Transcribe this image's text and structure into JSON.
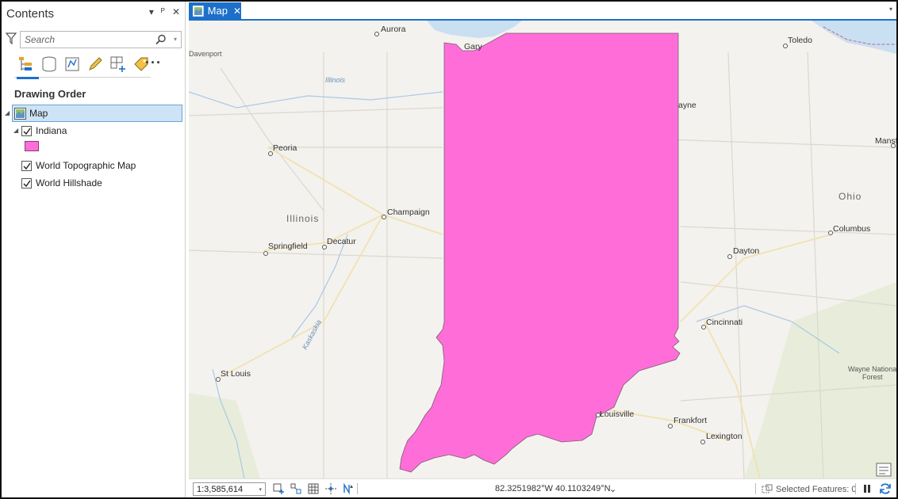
{
  "contents": {
    "title": "Contents",
    "pin_glyph": "▾  ⊥  ✕",
    "search": {
      "placeholder": "Search"
    },
    "toolbar_icons": [
      "list-by-drawing-order-icon",
      "list-by-data-source-icon",
      "list-by-selection-icon",
      "list-by-editing-icon",
      "list-by-snapping-icon",
      "list-by-labeling-icon",
      "more-icon"
    ],
    "section_title": "Drawing Order",
    "tree": {
      "map_label": "Map",
      "layers": [
        {
          "label": "Indiana",
          "checked": true,
          "expanded": true,
          "symbol_color": "#ff6ed8"
        },
        {
          "label": "World Topographic Map",
          "checked": true
        },
        {
          "label": "World Hillshade",
          "checked": true
        }
      ]
    }
  },
  "map_view": {
    "tab_label": "Map",
    "tab_close": "✕",
    "labels": {
      "aurora": "Aurora",
      "gary": "Gary",
      "toledo": "Toledo",
      "davenport": "Davenport",
      "illinois_river": "Illinois",
      "wayne": "ayne",
      "peoria": "Peoria",
      "mansf": "Mansf",
      "ohio": "Ohio",
      "illinois_state": "Illinois",
      "champaign": "Champaign",
      "columbus": "Columbus",
      "springfield": "Springfield",
      "decatur": "Decatur",
      "dayton": "Dayton",
      "cincinnati": "Cincinnati",
      "kaskaskia": "Kaskaskia",
      "st_louis": "St Louis",
      "wayne_forest_1": "Wayne National",
      "wayne_forest_2": "Forest",
      "louisville": "Louisville",
      "frankfort": "Frankfort",
      "lexington": "Lexington"
    },
    "colors": {
      "indiana_fill": "#ff6ed8",
      "water": "#c9dff2",
      "land": "#f4f2ee",
      "accent": "#1d70c9"
    }
  },
  "status": {
    "scale": "1:3,585,614",
    "coordinates": "82.3251982°W 40.1103249°N",
    "coords_caret": "⌄",
    "selected_features": "Selected Features: 0"
  }
}
